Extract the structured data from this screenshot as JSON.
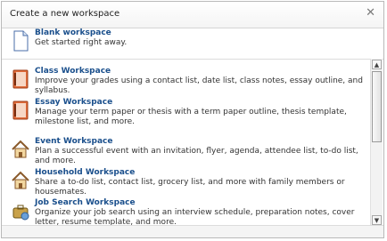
{
  "dialog": {
    "title": "Create a new workspace",
    "close_icon": "close-icon"
  },
  "blank": {
    "name": "Blank workspace",
    "desc": "Get started right away.",
    "icon": "document-icon"
  },
  "items": [
    {
      "name": "Class Workspace",
      "desc": "Improve your grades using a contact list, date list, class notes, essay outline, and syllabus.",
      "icon": "book-icon"
    },
    {
      "name": "Essay Workspace",
      "desc": "Manage your term paper or thesis with a term paper outline, thesis template, milestone list, and more.",
      "icon": "book-icon"
    },
    {
      "name": "Event Workspace",
      "desc": "Plan a successful event with an invitation, flyer, agenda, attendee list, to-do list, and more.",
      "icon": "house-icon"
    },
    {
      "name": "Household Workspace",
      "desc": "Share a to-do list, contact list, grocery list, and more with family members or housemates.",
      "icon": "house-icon"
    },
    {
      "name": "Job Search Workspace",
      "desc": "Organize your job search using an interview schedule, preparation notes, cover letter, resume template, and more.",
      "icon": "briefcase-icon"
    }
  ]
}
